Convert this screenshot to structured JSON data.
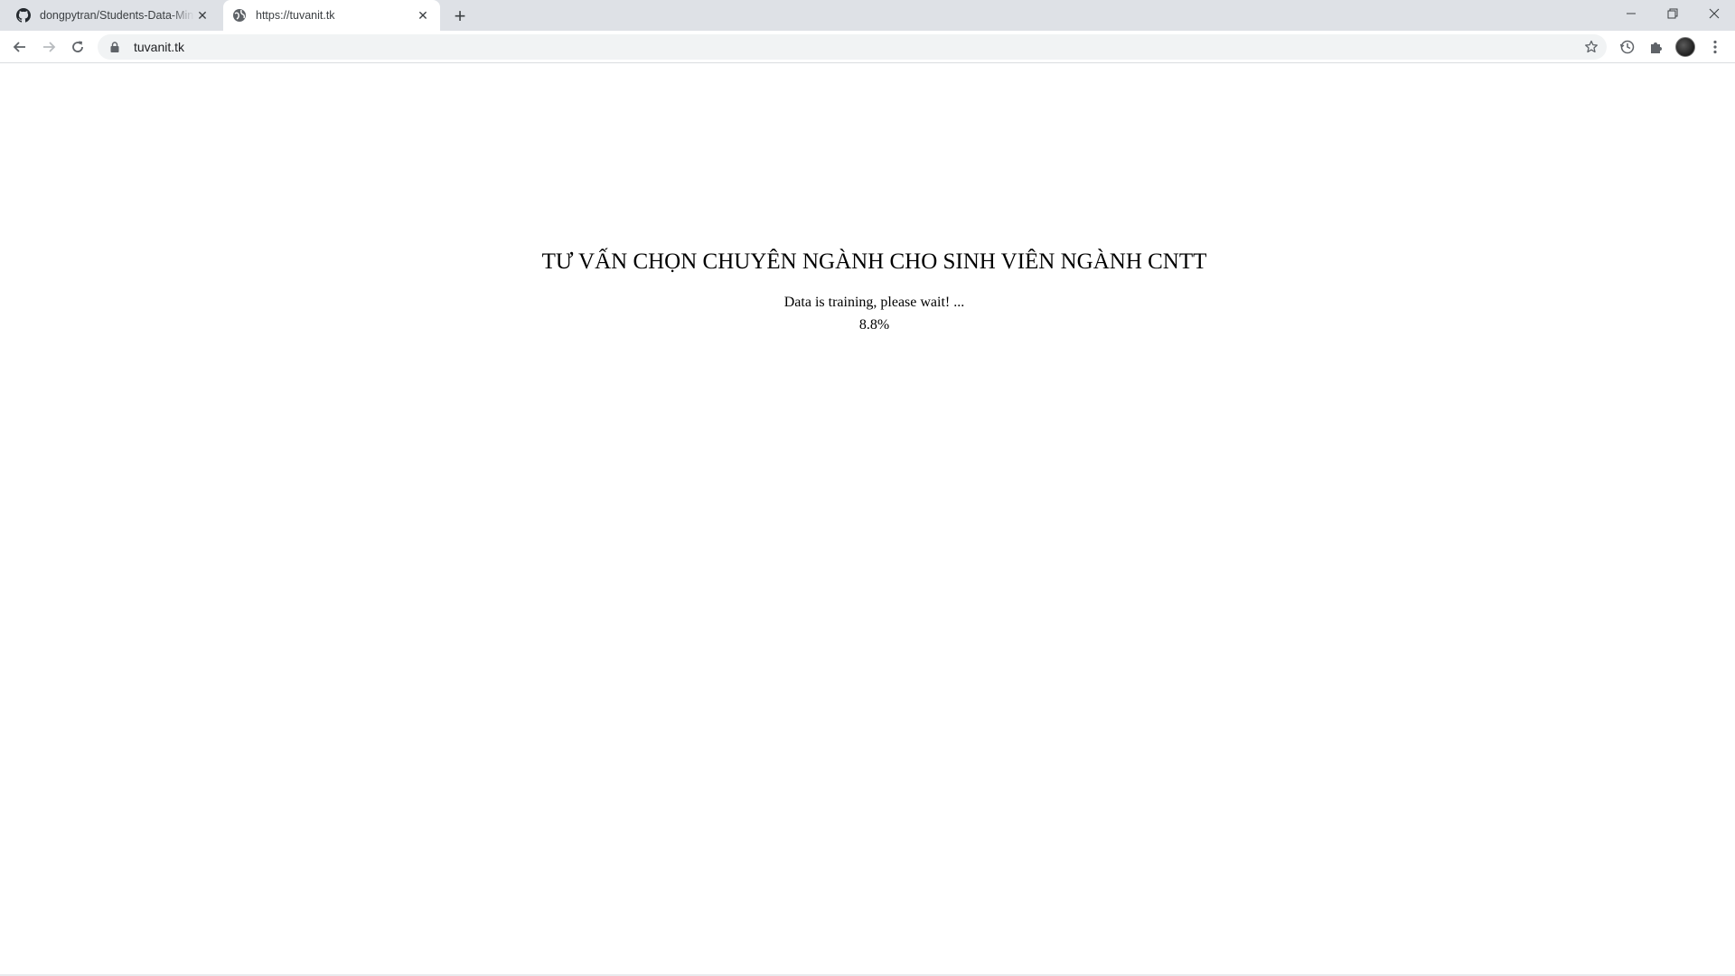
{
  "browser": {
    "tabs": [
      {
        "title": "dongpytran/Students-Data-Mining",
        "icon": "github-icon",
        "active": false
      },
      {
        "title": "https://tuvanit.tk",
        "icon": "globe-icon",
        "active": true
      }
    ],
    "address_bar": {
      "url": "tuvanit.tk"
    }
  },
  "page": {
    "heading": "TƯ VẤN CHỌN CHUYÊN NGÀNH CHO SINH VIÊN NGÀNH CNTT",
    "status": "Data is training, please wait! ...",
    "progress": "8.8%"
  }
}
